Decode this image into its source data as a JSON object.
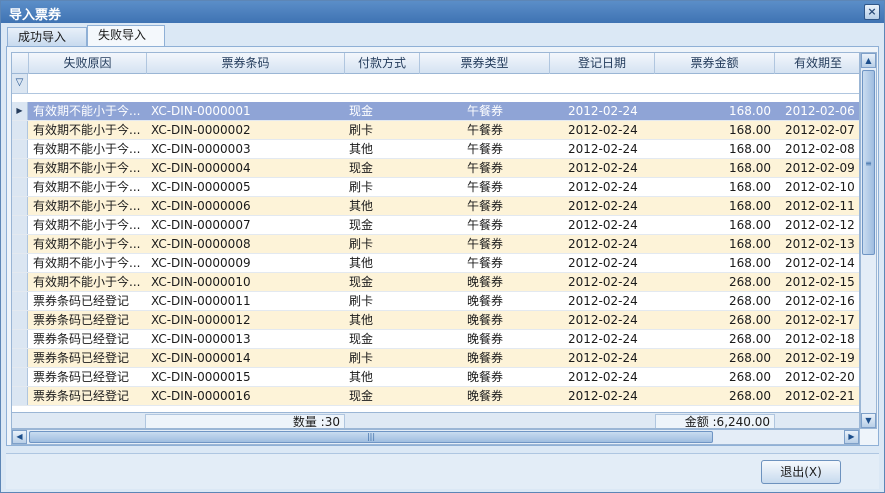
{
  "window": {
    "title": "导入票券",
    "close_glyph": "×"
  },
  "tabs": [
    {
      "label": "成功导入",
      "active": false
    },
    {
      "label": "失败导入",
      "active": true
    }
  ],
  "grid": {
    "columns": [
      "失败原因",
      "票券条码",
      "付款方式",
      "票券类型",
      "登记日期",
      "票券金额",
      "有效期至"
    ],
    "rows": [
      {
        "reason": "有效期不能小于今...",
        "code": "XC-DIN-0000001",
        "pay": "现金",
        "type": "午餐券",
        "date": "2012-02-24",
        "amount": "168.00",
        "expire": "2012-02-06",
        "selected": true
      },
      {
        "reason": "有效期不能小于今...",
        "code": "XC-DIN-0000002",
        "pay": "刷卡",
        "type": "午餐券",
        "date": "2012-02-24",
        "amount": "168.00",
        "expire": "2012-02-07"
      },
      {
        "reason": "有效期不能小于今...",
        "code": "XC-DIN-0000003",
        "pay": "其他",
        "type": "午餐券",
        "date": "2012-02-24",
        "amount": "168.00",
        "expire": "2012-02-08"
      },
      {
        "reason": "有效期不能小于今...",
        "code": "XC-DIN-0000004",
        "pay": "现金",
        "type": "午餐券",
        "date": "2012-02-24",
        "amount": "168.00",
        "expire": "2012-02-09"
      },
      {
        "reason": "有效期不能小于今...",
        "code": "XC-DIN-0000005",
        "pay": "刷卡",
        "type": "午餐券",
        "date": "2012-02-24",
        "amount": "168.00",
        "expire": "2012-02-10"
      },
      {
        "reason": "有效期不能小于今...",
        "code": "XC-DIN-0000006",
        "pay": "其他",
        "type": "午餐券",
        "date": "2012-02-24",
        "amount": "168.00",
        "expire": "2012-02-11"
      },
      {
        "reason": "有效期不能小于今...",
        "code": "XC-DIN-0000007",
        "pay": "现金",
        "type": "午餐券",
        "date": "2012-02-24",
        "amount": "168.00",
        "expire": "2012-02-12"
      },
      {
        "reason": "有效期不能小于今...",
        "code": "XC-DIN-0000008",
        "pay": "刷卡",
        "type": "午餐券",
        "date": "2012-02-24",
        "amount": "168.00",
        "expire": "2012-02-13"
      },
      {
        "reason": "有效期不能小于今...",
        "code": "XC-DIN-0000009",
        "pay": "其他",
        "type": "午餐券",
        "date": "2012-02-24",
        "amount": "168.00",
        "expire": "2012-02-14"
      },
      {
        "reason": "有效期不能小于今...",
        "code": "XC-DIN-0000010",
        "pay": "现金",
        "type": "晚餐券",
        "date": "2012-02-24",
        "amount": "268.00",
        "expire": "2012-02-15"
      },
      {
        "reason": "票券条码已经登记",
        "code": "XC-DIN-0000011",
        "pay": "刷卡",
        "type": "晚餐券",
        "date": "2012-02-24",
        "amount": "268.00",
        "expire": "2012-02-16"
      },
      {
        "reason": "票券条码已经登记",
        "code": "XC-DIN-0000012",
        "pay": "其他",
        "type": "晚餐券",
        "date": "2012-02-24",
        "amount": "268.00",
        "expire": "2012-02-17"
      },
      {
        "reason": "票券条码已经登记",
        "code": "XC-DIN-0000013",
        "pay": "现金",
        "type": "晚餐券",
        "date": "2012-02-24",
        "amount": "268.00",
        "expire": "2012-02-18"
      },
      {
        "reason": "票券条码已经登记",
        "code": "XC-DIN-0000014",
        "pay": "刷卡",
        "type": "晚餐券",
        "date": "2012-02-24",
        "amount": "268.00",
        "expire": "2012-02-19"
      },
      {
        "reason": "票券条码已经登记",
        "code": "XC-DIN-0000015",
        "pay": "其他",
        "type": "晚餐券",
        "date": "2012-02-24",
        "amount": "268.00",
        "expire": "2012-02-20"
      },
      {
        "reason": "票券条码已经登记",
        "code": "XC-DIN-0000016",
        "pay": "现金",
        "type": "晚餐券",
        "date": "2012-02-24",
        "amount": "268.00",
        "expire": "2012-02-21"
      }
    ],
    "footer": {
      "count": "数量 :30",
      "total": "金额 :6,240.00"
    }
  },
  "icons": {
    "filter": "funnel-icon",
    "row_indicator": "triangle-right-icon"
  },
  "buttons": {
    "exit": "退出(X)"
  },
  "colors": {
    "selected_row": "#8fa4d6",
    "alt_row": "#fdf3d8",
    "title_bar": "#4a80bf"
  }
}
